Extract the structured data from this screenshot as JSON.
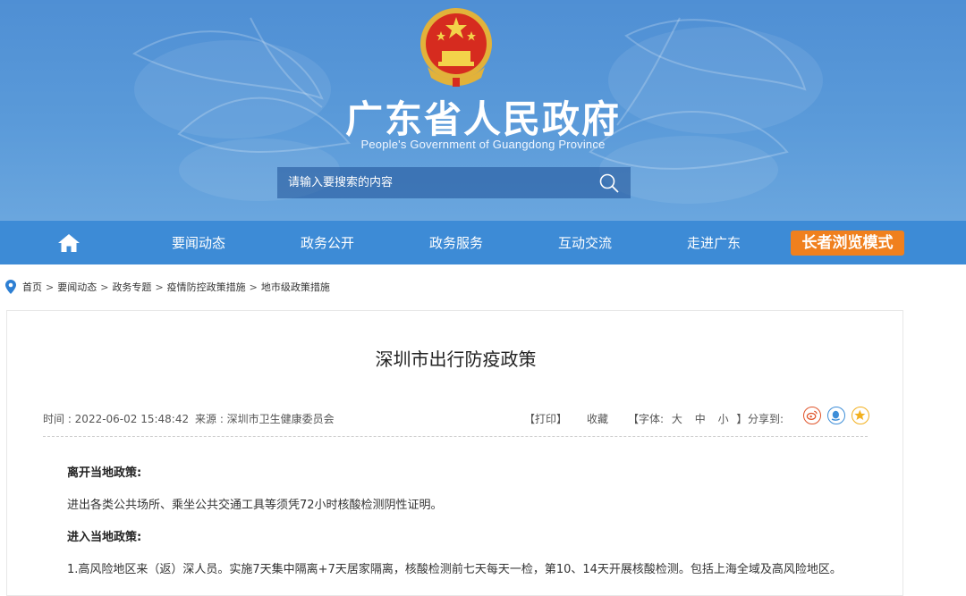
{
  "header": {
    "title": "广东省人民政府",
    "subtitle": "People's Government of Guangdong Province",
    "search_placeholder": "请输入要搜索的内容"
  },
  "nav": {
    "items": [
      "要闻动态",
      "政务公开",
      "政务服务",
      "互动交流",
      "走进广东"
    ],
    "elder_mode": "长者浏览模式"
  },
  "breadcrumb": [
    "首页",
    "要闻动态",
    "政务专题",
    "疫情防控政策措施",
    "地市级政策措施"
  ],
  "article": {
    "title": "深圳市出行防疫政策",
    "time": "时间 : 2022-06-02 15:48:42",
    "source": "来源 : 深圳市卫生健康委员会",
    "print": "【打印】",
    "favorite": "收藏",
    "font_label": "【字体:",
    "font_large": "大",
    "font_medium": "中",
    "font_small": "小",
    "font_close": "】",
    "share_label": "分享到:",
    "paragraphs": [
      "离开当地政策:",
      "进出各类公共场所、乘坐公共交通工具等须凭72小时核酸检测阴性证明。",
      "进入当地政策:",
      "1.高风险地区来（返）深人员。实施7天集中隔离+7天居家隔离，核酸检测前七天每天一检，第10、14天开展核酸检测。包括上海全域及高风险地区。"
    ]
  },
  "colors": {
    "banner": "#5a9ad9",
    "nav": "#3d8bd6",
    "elder_button": "#f0801e",
    "weibo": "#e0552b",
    "qq": "#3e8ed8",
    "qzone": "#f2b01e"
  }
}
